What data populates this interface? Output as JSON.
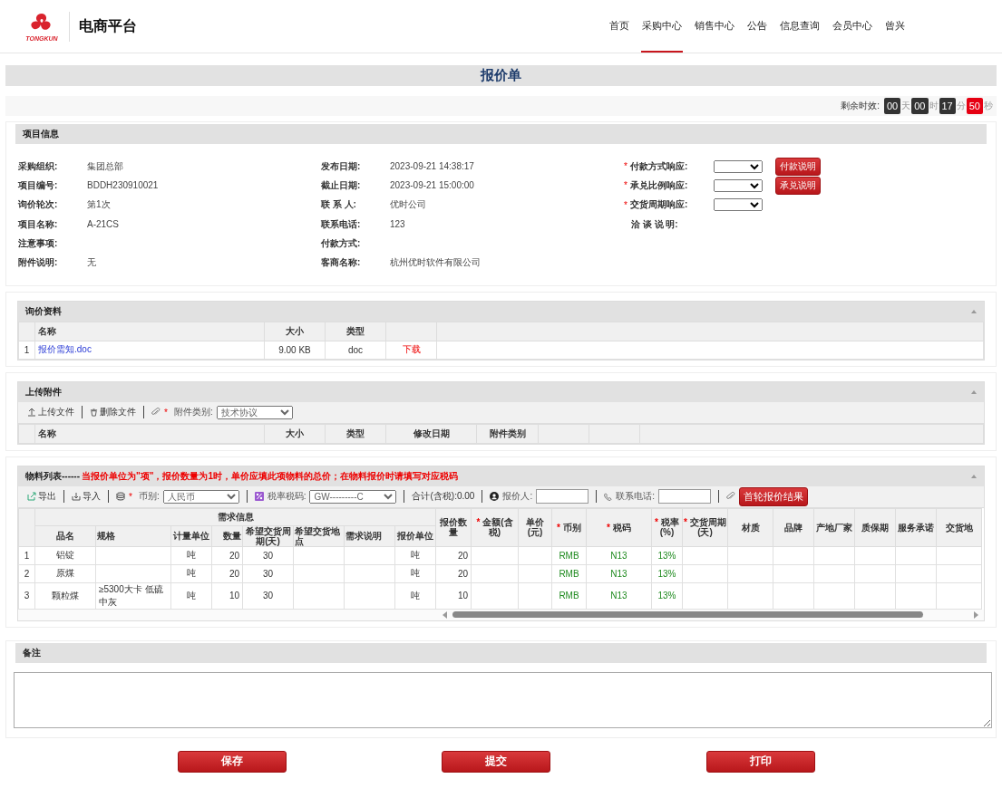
{
  "header": {
    "logo_text": "TONGKUN",
    "site_name": "电商平台",
    "nav": [
      {
        "label": "首页",
        "selected": false
      },
      {
        "label": "采购中心",
        "selected": true
      },
      {
        "label": "销售中心",
        "selected": false
      },
      {
        "label": "公告",
        "selected": false
      },
      {
        "label": "信息查询",
        "selected": false
      },
      {
        "label": "会员中心",
        "selected": false
      },
      {
        "label": "曾兴",
        "selected": false
      }
    ]
  },
  "page_title": "报价单",
  "countdown": {
    "label": "剩余时效:",
    "parts": [
      {
        "value": "00",
        "unit": "天",
        "alert": false
      },
      {
        "value": "00",
        "unit": "时",
        "alert": false
      },
      {
        "value": "17",
        "unit": "分",
        "alert": false
      },
      {
        "value": "50",
        "unit": "秒",
        "alert": true
      }
    ]
  },
  "project_info": {
    "title": "项目信息",
    "left": [
      {
        "label": "采购组织:",
        "value": "集团总部"
      },
      {
        "label": "项目编号:",
        "value": "BDDH230910021"
      },
      {
        "label": "询价轮次:",
        "value": "第1次"
      },
      {
        "label": "项目名称:",
        "value": "A-21CS"
      },
      {
        "label": "注意事项:"
      },
      {
        "label": "附件说明:",
        "value": "无"
      }
    ],
    "middle": [
      {
        "label": "发布日期:",
        "value": "2023-09-21 14:38:17"
      },
      {
        "label": "截止日期:",
        "value": "2023-09-21 15:00:00"
      },
      {
        "label": "联 系 人:",
        "value": "优时公司"
      },
      {
        "label": "联系电话:",
        "value": "123"
      },
      {
        "label": "付款方式:"
      },
      {
        "label": "客商名称:",
        "value": "杭州优时软件有限公司"
      }
    ],
    "right": [
      {
        "kind": "select",
        "required_mark": "*",
        "label": "付款方式响应:",
        "button": "付款说明"
      },
      {
        "kind": "select",
        "required_mark": "*",
        "label": "承兑比例响应:",
        "button": "承兑说明"
      },
      {
        "kind": "select",
        "required_mark": "*",
        "label": "交货周期响应:"
      },
      {
        "kind": "text",
        "label": "洽 谈 说 明:"
      }
    ]
  },
  "inquiry_docs": {
    "title": "询价资料",
    "columns": [
      "名称",
      "大小",
      "类型"
    ],
    "rows": [
      {
        "index": "1",
        "name": "报价需知.doc",
        "size": "9.00 KB",
        "type": "doc",
        "action": "下载"
      }
    ]
  },
  "attachments": {
    "title": "上传附件",
    "toolbar": {
      "upload": "上传文件",
      "delete": "删除文件",
      "required_mark": "*",
      "category_label": "附件类别:",
      "category_value": "技术协议"
    },
    "columns": [
      "名称",
      "大小",
      "类型",
      "修改日期",
      "附件类别"
    ]
  },
  "materials": {
    "title": "物料列表------",
    "notice": "当报价单位为\"项\"，报价数量为1时，单价应填此项物料的总价；在物料报价时请填写对应税码",
    "toolbar": {
      "export": "导出",
      "import": "导入",
      "currency_mark": "*",
      "currency_label": "币别:",
      "currency_value": "人民币",
      "tax_label": "税率税码:",
      "tax_value": "GW---------C",
      "total": "合计(含税):0.00",
      "quoter_label": "报价人:",
      "phone_label": "联系电话:",
      "result_button": "首轮报价结果"
    },
    "group_header": "需求信息",
    "columns": [
      {
        "label": "品名",
        "kind": "center",
        "in_group": true
      },
      {
        "label": "规格",
        "kind": "left",
        "in_group": true
      },
      {
        "label": "计量单位",
        "kind": "center",
        "in_group": true
      },
      {
        "label": "数量",
        "kind": "right",
        "in_group": true
      },
      {
        "label": "希望交货周期(天)",
        "kind": "center",
        "in_group": true
      },
      {
        "label": "希望交货地点",
        "kind": "left",
        "in_group": true
      },
      {
        "label": "需求说明",
        "kind": "left",
        "in_group": true
      },
      {
        "label": "报价单位",
        "kind": "center",
        "in_group": true
      },
      {
        "label": "报价数量",
        "kind": "right",
        "in_group": false
      },
      {
        "label": "金额(含税)",
        "required_mark": "*",
        "in_group": false
      },
      {
        "label": "单价(元)",
        "in_group": false
      },
      {
        "label": "币别",
        "kind": "auto",
        "required_mark": "*",
        "in_group": false
      },
      {
        "label": "税码",
        "kind": "auto",
        "required_mark": "*",
        "in_group": false
      },
      {
        "label": "税率(%)",
        "kind": "auto",
        "required_mark": "*",
        "in_group": false
      },
      {
        "label": "交货周期(天)",
        "required_mark": "*",
        "in_group": false
      },
      {
        "label": "材质",
        "in_group": false
      },
      {
        "label": "品牌",
        "in_group": false
      },
      {
        "label": "产地厂家",
        "in_group": false
      },
      {
        "label": "质保期",
        "in_group": false
      },
      {
        "label": "服务承诺",
        "in_group": false
      },
      {
        "label": "交货地",
        "in_group": false
      }
    ],
    "rows": [
      {
        "index": "1",
        "cells": [
          "铝锭",
          null,
          "吨",
          "20",
          "30",
          null,
          null,
          "吨",
          "20",
          null,
          null,
          "RMB",
          "N13",
          "13%",
          null,
          null,
          null,
          null,
          null,
          null,
          null
        ]
      },
      {
        "index": "2",
        "cells": [
          "原煤",
          null,
          "吨",
          "20",
          "30",
          null,
          null,
          "吨",
          "20",
          null,
          null,
          "RMB",
          "N13",
          "13%",
          null,
          null,
          null,
          null,
          null,
          null,
          null
        ]
      },
      {
        "index": "3",
        "cells": [
          "颗粒煤",
          "≥5300大卡 低硫中灰",
          "吨",
          "10",
          "30",
          null,
          null,
          "吨",
          "10",
          null,
          null,
          "RMB",
          "N13",
          "13%",
          null,
          null,
          null,
          null,
          null,
          null,
          null
        ]
      }
    ]
  },
  "remarks": {
    "label": "备注"
  },
  "buttons": [
    "保存",
    "提交",
    "打印"
  ]
}
